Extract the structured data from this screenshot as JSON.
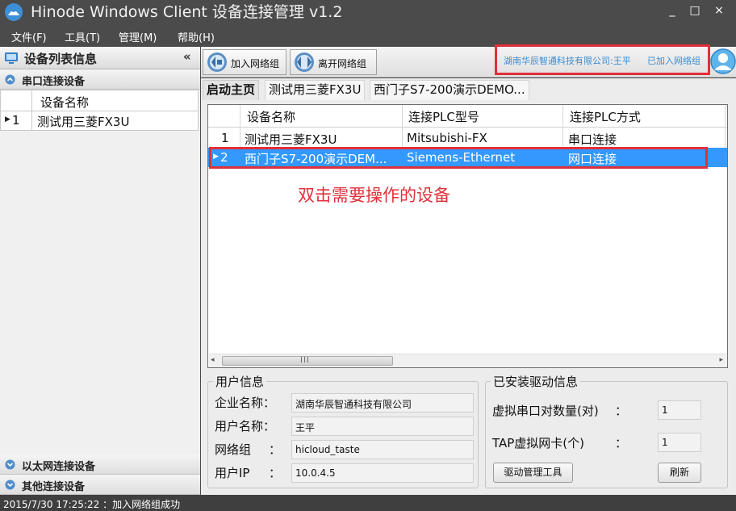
{
  "window": {
    "title": "Hinode Windows Client 设备连接管理 v1.2",
    "controls": {
      "minimize": "_",
      "maximize": "□",
      "close": "×"
    }
  },
  "menu": [
    "文件(F)",
    "工具(T)",
    "管理(M)",
    "帮助(H)"
  ],
  "sidebar": {
    "title": "设备列表信息",
    "collapse": "«",
    "groups": {
      "serial": "串口连接设备",
      "ethernet": "以太网连接设备",
      "other": "其他连接设备"
    },
    "grid": {
      "header": "设备名称",
      "rows": [
        {
          "index": "1",
          "name": "测试用三菱FX3U"
        }
      ]
    }
  },
  "toolbar": {
    "join_label": "加入网络组",
    "leave_label": "离开网络组",
    "user_company": "湖南华辰智通科技有限公司:王平",
    "joined_status": "已加入网络组"
  },
  "tabs": [
    {
      "label": "启动主页",
      "active": true
    },
    {
      "label": "测试用三菱FX3U",
      "active": false
    },
    {
      "label": "西门子S7-200演示DEMO...",
      "active": false
    }
  ],
  "device_grid": {
    "columns": [
      "设备名称",
      "连接PLC型号",
      "连接PLC方式"
    ],
    "rows": [
      {
        "index": "1",
        "name": "测试用三菱FX3U",
        "model": "Mitsubishi-FX",
        "method": "串口连接",
        "selected": false
      },
      {
        "index": "2",
        "name": "西门子S7-200演示DEM...",
        "model": "Siemens-Ethernet",
        "method": "网口连接",
        "selected": true
      }
    ],
    "hint": "双击需要操作的设备",
    "scrollbar_grip": "III"
  },
  "user_info": {
    "title": "用户信息",
    "company_label": "企业名称：",
    "company_value": "湖南华辰智通科技有限公司",
    "username_label": "用户名称：",
    "username_value": "王平",
    "network_label": "网络组",
    "network_colon": "：",
    "network_value": "hicloud_taste",
    "ip_label": "用户IP",
    "ip_colon": "：",
    "ip_value": "10.0.4.5"
  },
  "driver_info": {
    "title": "已安装驱动信息",
    "serial_pairs_label": "虚拟串口对数量(对)",
    "serial_pairs_colon": "：",
    "serial_pairs_value": "1",
    "tap_label": "TAP虚拟网卡(个)",
    "tap_colon": "：",
    "tap_value": "1",
    "driver_tool_button": "驱动管理工具",
    "refresh_button": "刷新"
  },
  "status": {
    "timestamp": "2015/7/30 17:25:22",
    "message": "：加入网络组成功"
  },
  "colors": {
    "highlight_red": "#e0303a",
    "selection_blue": "#3399ff",
    "link_blue": "#3a8cd0",
    "titlebar_gray": "#4b4b4b"
  }
}
